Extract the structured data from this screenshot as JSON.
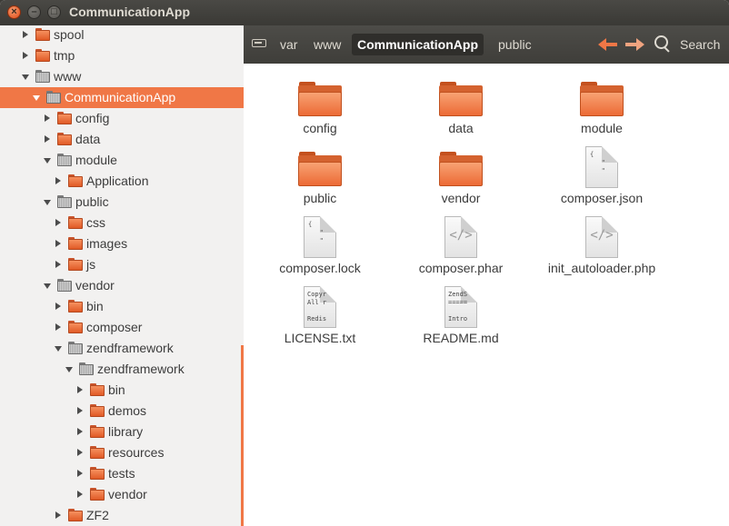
{
  "window": {
    "title": "CommunicationApp"
  },
  "titlebar_buttons": {
    "close": "×",
    "minimize": "–",
    "maximize": "□"
  },
  "sidebar": {
    "items": [
      {
        "label": "spool",
        "state": "collapsed",
        "icon": "folder-orange"
      },
      {
        "label": "tmp",
        "state": "collapsed",
        "icon": "folder-orange"
      },
      {
        "label": "www",
        "state": "expanded",
        "icon": "folder-gray"
      },
      {
        "label": "CommunicationApp",
        "state": "expanded",
        "icon": "folder-gray",
        "selected": true
      },
      {
        "label": "config",
        "state": "collapsed",
        "icon": "folder-orange"
      },
      {
        "label": "data",
        "state": "collapsed",
        "icon": "folder-orange"
      },
      {
        "label": "module",
        "state": "expanded",
        "icon": "folder-gray"
      },
      {
        "label": "Application",
        "state": "collapsed",
        "icon": "folder-orange"
      },
      {
        "label": "public",
        "state": "expanded",
        "icon": "folder-gray"
      },
      {
        "label": "css",
        "state": "collapsed",
        "icon": "folder-orange"
      },
      {
        "label": "images",
        "state": "collapsed",
        "icon": "folder-orange"
      },
      {
        "label": "js",
        "state": "collapsed",
        "icon": "folder-orange"
      },
      {
        "label": "vendor",
        "state": "expanded",
        "icon": "folder-gray"
      },
      {
        "label": "bin",
        "state": "collapsed",
        "icon": "folder-orange"
      },
      {
        "label": "composer",
        "state": "collapsed",
        "icon": "folder-orange"
      },
      {
        "label": "zendframework",
        "state": "expanded",
        "icon": "folder-gray"
      },
      {
        "label": "zendframework",
        "state": "expanded",
        "icon": "folder-gray"
      },
      {
        "label": "bin",
        "state": "collapsed",
        "icon": "folder-orange"
      },
      {
        "label": "demos",
        "state": "collapsed",
        "icon": "folder-orange"
      },
      {
        "label": "library",
        "state": "collapsed",
        "icon": "folder-orange"
      },
      {
        "label": "resources",
        "state": "collapsed",
        "icon": "folder-orange"
      },
      {
        "label": "tests",
        "state": "collapsed",
        "icon": "folder-orange"
      },
      {
        "label": "vendor",
        "state": "collapsed",
        "icon": "folder-orange"
      },
      {
        "label": "ZF2",
        "state": "collapsed",
        "icon": "folder-orange"
      }
    ]
  },
  "breadcrumb": {
    "items": [
      "var",
      "www",
      "CommunicationApp",
      "public"
    ],
    "active": "CommunicationApp"
  },
  "toolbar": {
    "search_label": "Search"
  },
  "files": [
    {
      "name": "config",
      "kind": "folder"
    },
    {
      "name": "data",
      "kind": "folder"
    },
    {
      "name": "module",
      "kind": "folder"
    },
    {
      "name": "public",
      "kind": "folder"
    },
    {
      "name": "vendor",
      "kind": "folder"
    },
    {
      "name": "composer.json",
      "kind": "json"
    },
    {
      "name": "composer.lock",
      "kind": "json"
    },
    {
      "name": "composer.phar",
      "kind": "code"
    },
    {
      "name": "init_autoloader.php",
      "kind": "code"
    },
    {
      "name": "LICENSE.txt",
      "kind": "text",
      "preview": "Copyr\nAll r\n\nRedis"
    },
    {
      "name": "README.md",
      "kind": "text",
      "preview": "ZendS\n=====\n\nIntro"
    }
  ],
  "colors": {
    "accent": "#f07746",
    "titlebar": "#3c3b37",
    "sidebar": "#f2f1f0"
  }
}
